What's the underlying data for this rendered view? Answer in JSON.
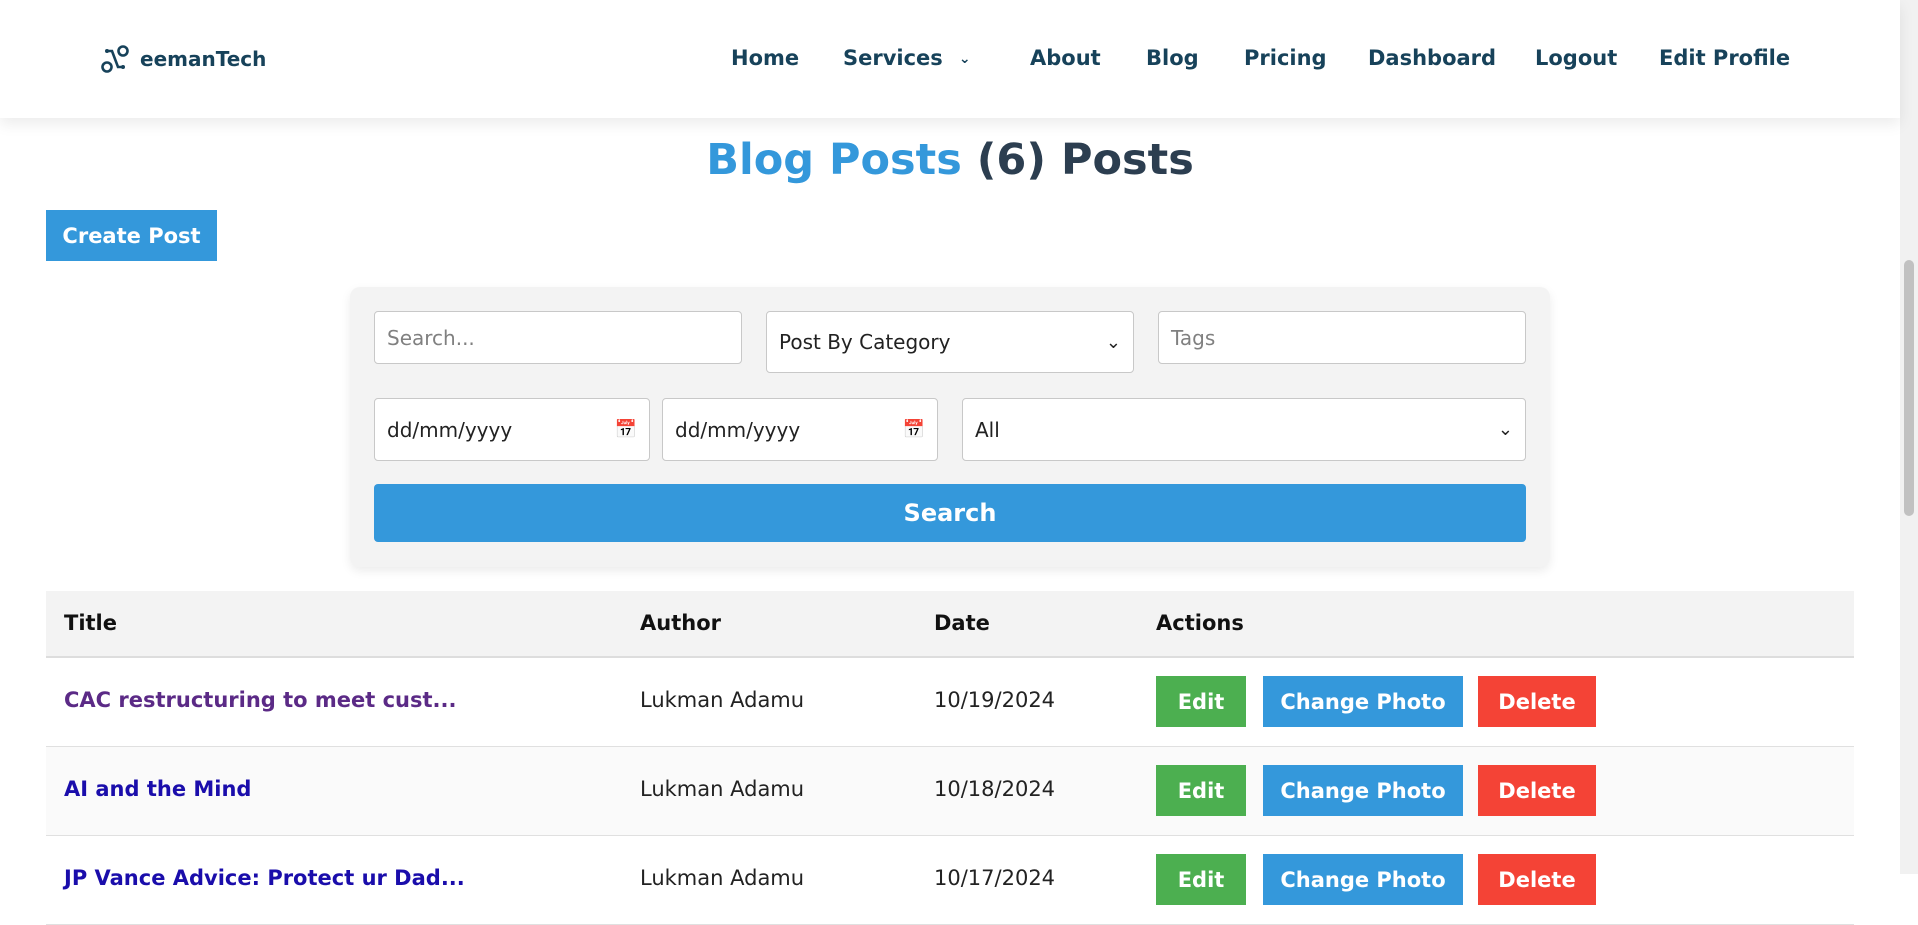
{
  "brand": {
    "name": "eemanTech",
    "color": "#17425a"
  },
  "nav": {
    "home": "Home",
    "services": "Services",
    "about": "About",
    "blog": "Blog",
    "pricing": "Pricing",
    "dashboard": "Dashboard",
    "logout": "Logout",
    "edit_profile": "Edit Profile"
  },
  "page": {
    "title_highlight": "Blog Posts",
    "title_count": "(6)",
    "title_suffix": "Posts",
    "create_label": "Create Post"
  },
  "filters": {
    "search_placeholder": "Search...",
    "category_value": "Post By Category",
    "tags_placeholder": "Tags",
    "date_from": "dd/mm/yyyy",
    "date_to": "dd/mm/yyyy",
    "status_value": "All",
    "search_label": "Search"
  },
  "table": {
    "headers": {
      "title": "Title",
      "author": "Author",
      "date": "Date",
      "actions": "Actions"
    },
    "actions": {
      "edit": "Edit",
      "photo": "Change Photo",
      "delete": "Delete"
    },
    "rows": [
      {
        "title": "CAC restructuring to meet cust...",
        "author": "Lukman Adamu",
        "date": "10/19/2024"
      },
      {
        "title": "AI and the Mind",
        "author": "Lukman Adamu",
        "date": "10/18/2024"
      },
      {
        "title": "JP Vance Advice: Protect ur Dad...",
        "author": "Lukman Adamu",
        "date": "10/17/2024"
      }
    ]
  },
  "colors": {
    "accent": "#3498db",
    "edit": "#4caf50",
    "delete": "#f44336",
    "heading": "#2c3e50"
  }
}
